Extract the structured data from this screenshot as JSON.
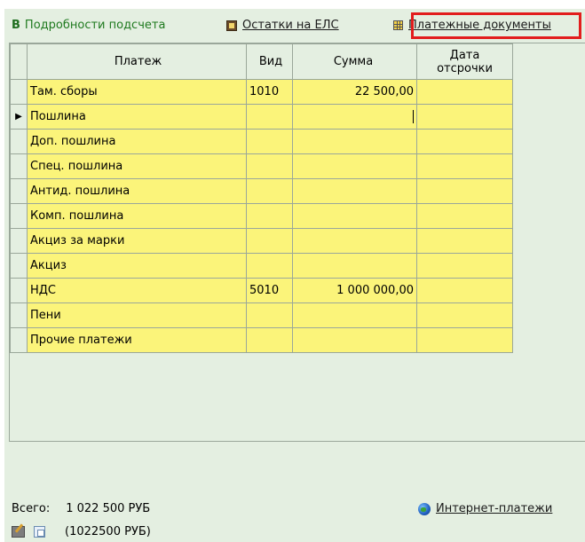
{
  "toolbar": {
    "details_icon": "B",
    "details_label": "Подробности подсчета",
    "balance_label": "Остатки на ЕЛС",
    "docs_label": "Платежные документы"
  },
  "table": {
    "headers": {
      "name": "Платеж",
      "kind": "Вид",
      "sum": "Сумма",
      "date_line1": "Дата",
      "date_line2": "отсрочки"
    },
    "rows": [
      {
        "name": "Там. сборы",
        "kind": "1010",
        "sum": "22 500,00",
        "date": ""
      },
      {
        "name": "Пошлина",
        "kind": "",
        "sum": "",
        "date": "",
        "current": true
      },
      {
        "name": "Доп. пошлина",
        "kind": "",
        "sum": "",
        "date": ""
      },
      {
        "name": "Спец. пошлина",
        "kind": "",
        "sum": "",
        "date": ""
      },
      {
        "name": "Антид. пошлина",
        "kind": "",
        "sum": "",
        "date": ""
      },
      {
        "name": "Комп. пошлина",
        "kind": "",
        "sum": "",
        "date": ""
      },
      {
        "name": "Акциз за марки",
        "kind": "",
        "sum": "",
        "date": ""
      },
      {
        "name": "Акциз",
        "kind": "",
        "sum": "",
        "date": ""
      },
      {
        "name": "НДС",
        "kind": "5010",
        "sum": "1 000 000,00",
        "date": ""
      },
      {
        "name": "Пени",
        "kind": "",
        "sum": "",
        "date": ""
      },
      {
        "name": "Прочие платежи",
        "kind": "",
        "sum": "",
        "date": ""
      }
    ],
    "row_indicator": "▶"
  },
  "footer": {
    "total_label": "Всего:",
    "total_amount": "1 022 500 РУБ",
    "sub_total": "(1022500 РУБ)",
    "internet_label": "Интернет-платежи"
  },
  "colors": {
    "panel": "#e4efe1",
    "cell": "#fbf47a",
    "highlight": "#e21d1d",
    "details_text": "#1f7a1f"
  },
  "icons": [
    "ledger-icon",
    "grid-icon",
    "globe-icon",
    "edit-icon",
    "copy-icon"
  ]
}
